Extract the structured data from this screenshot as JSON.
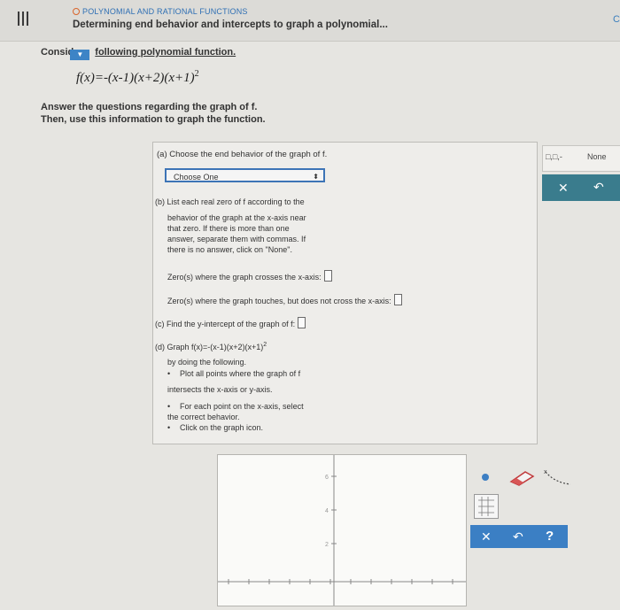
{
  "header": {
    "subject": "POLYNOMIAL AND RATIONAL FUNCTIONS",
    "topic": "Determining end behavior and intercepts to graph a polynomial...",
    "edge_glyph": "C"
  },
  "intro": {
    "word1": "Consid",
    "link": "following polynomial function.",
    "formula": "f(x)=-(x-1)(x+2)(x+1)",
    "formula_exp": "2"
  },
  "instructions": {
    "line1": "Answer the questions regarding the graph of f.",
    "line2": "Then, use this information to graph the function."
  },
  "part_a": {
    "label": "(a) Choose the end behavior of the graph of f.",
    "select_value": "Choose One",
    "spin": "⬍"
  },
  "part_b": {
    "label": "(b) List each real zero of f according to the",
    "l2": "behavior of the graph at the x-axis near",
    "l3": "that zero. If there is more than one",
    "l4": "answer, separate them with commas. If",
    "l5": "there is no answer, click on \"None\".",
    "crosses": "Zero(s) where the graph crosses the x-axis:",
    "touches": "Zero(s) where the graph touches, but does not cross the x-axis:"
  },
  "part_c": {
    "label": "(c) Find the y-intercept of the graph of f:"
  },
  "part_d": {
    "label": "(d) Graph f(x)=-(x-1)(x+2)(x+1)",
    "exp": "2",
    "l2": "by doing the following.",
    "b1": "Plot all points where the graph of f",
    "b1b": "intersects the x-axis or y-axis.",
    "b2": "For each point on the x-axis, select",
    "b2b": "the correct behavior.",
    "b3": "Click on the graph icon."
  },
  "side": {
    "interval": "□,□,-",
    "none": "None",
    "x": "✕",
    "undo": "↶"
  },
  "tools": {
    "x": "✕",
    "undo": "↶",
    "help": "?"
  },
  "graph": {
    "y_labels": [
      "6",
      "4",
      "2"
    ],
    "x_ticks": 12
  }
}
